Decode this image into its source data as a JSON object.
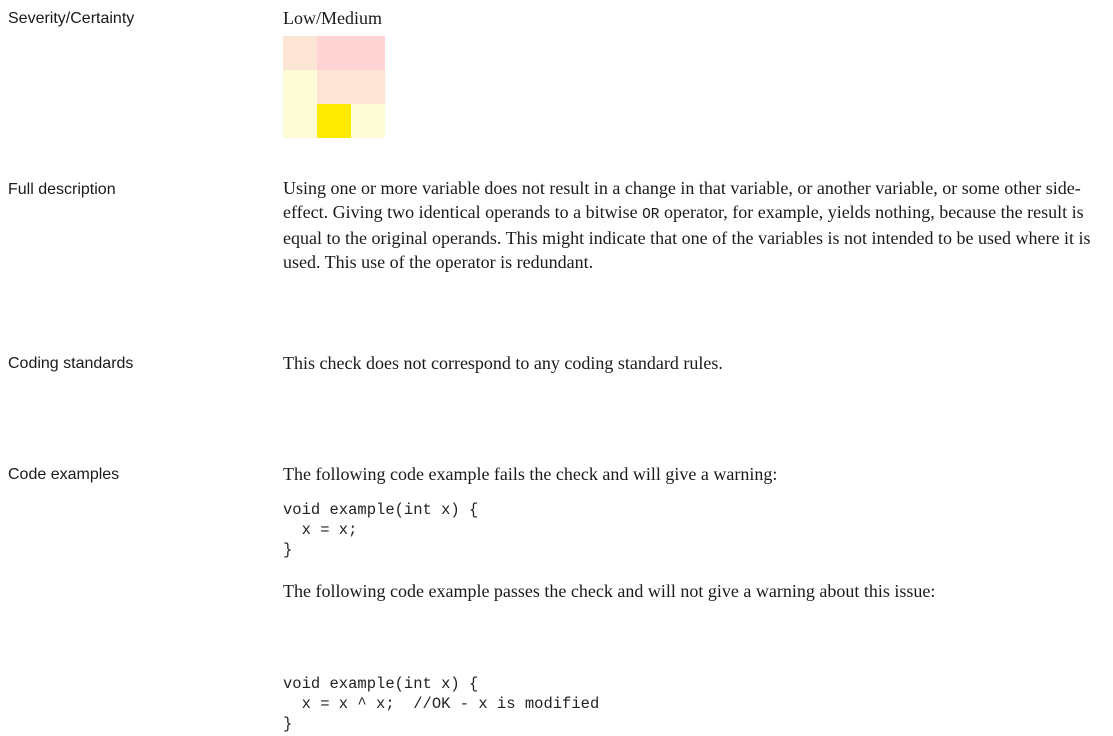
{
  "rows": {
    "severity": {
      "label": "Severity/Certainty",
      "value": "Low/Medium",
      "matrix_colors": [
        [
          "#FDE5D6",
          "#FDD3D3",
          "#FDD3D3"
        ],
        [
          "#FEFBD7",
          "#FDE5D6",
          "#FDE5D6"
        ],
        [
          "#FEFBD7",
          "#FFEB00",
          "#FEFBD7"
        ]
      ]
    },
    "description": {
      "label": "Full description",
      "text_before_code": " Using one or more variable does not result in a change in that variable, or another variable, or some other side-effect. Giving two identical operands to a bitwise ",
      "inline_code": "OR",
      "text_after_code": " operator, for example, yields nothing, because the result is equal to the original operands.  This might indicate that one of the variables is not intended to be used where it is used. This use of the operator is redundant."
    },
    "coding_standards": {
      "label": "Coding standards",
      "text": "This check does not correspond to any coding standard rules."
    },
    "code_examples": {
      "label": "Code examples",
      "fail_intro": "The following code example fails the check and will give a warning:",
      "fail_code": "void example(int x) {\n  x = x;\n}",
      "pass_intro": "The following code example passes the check and will not give a warning about this issue:",
      "pass_code": "void example(int x) {\n  x = x ^ x;  //OK - x is modified\n}"
    }
  }
}
